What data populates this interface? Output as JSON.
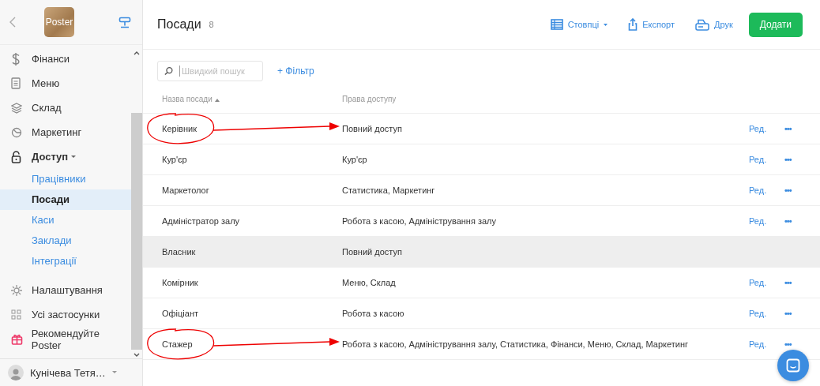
{
  "sidebar": {
    "logo": "Poster",
    "items": [
      {
        "label": "Фінанси",
        "expanded": false
      },
      {
        "label": "Меню",
        "expanded": false
      },
      {
        "label": "Склад",
        "expanded": false
      },
      {
        "label": "Маркетинг",
        "expanded": false
      },
      {
        "label": "Доступ",
        "expanded": true,
        "children": [
          {
            "label": "Працівники",
            "selected": false
          },
          {
            "label": "Посади",
            "selected": true
          },
          {
            "label": "Каси",
            "selected": false
          },
          {
            "label": "Заклади",
            "selected": false
          },
          {
            "label": "Інтеграції",
            "selected": false
          }
        ]
      },
      {
        "label": "Налаштування",
        "expanded": false
      },
      {
        "label": "Усі застосунки",
        "expanded": false
      },
      {
        "label": "Рекомендуйте Poster",
        "expanded": false
      }
    ],
    "user": "Кунічева Тетя…"
  },
  "header": {
    "title": "Посади",
    "count": "8",
    "actions": [
      "Стовпці",
      "Експорт",
      "Друк"
    ],
    "add_button": "Додати"
  },
  "search": {
    "placeholder": "Швидкий пошук"
  },
  "filter": "+ Фільтр",
  "table": {
    "columns": [
      {
        "label": "Назва посади",
        "sorted": true
      },
      {
        "label": "Права доступу",
        "sorted": false
      }
    ],
    "rows": [
      {
        "name": "Керівник",
        "access": "Повний доступ",
        "editable": true,
        "hovered": false,
        "annotated": true,
        "edit": "Ред.",
        "menu": "•••"
      },
      {
        "name": "Кур'єр",
        "access": "Кур'єр",
        "editable": true,
        "hovered": false,
        "annotated": false,
        "edit": "Ред.",
        "menu": "•••"
      },
      {
        "name": "Маркетолог",
        "access": "Статистика, Маркетинг",
        "editable": true,
        "hovered": false,
        "annotated": false,
        "edit": "Ред.",
        "menu": "•••"
      },
      {
        "name": "Адміністратор залу",
        "access": "Робота з касою, Адміністрування залу",
        "editable": true,
        "hovered": false,
        "annotated": false,
        "edit": "Ред.",
        "menu": "•••"
      },
      {
        "name": "Власник",
        "access": "Повний доступ",
        "editable": false,
        "hovered": true,
        "annotated": false
      },
      {
        "name": "Комірник",
        "access": "Меню, Склад",
        "editable": true,
        "hovered": false,
        "annotated": false,
        "edit": "Ред.",
        "menu": "•••"
      },
      {
        "name": "Офіціант",
        "access": "Робота з касою",
        "editable": true,
        "hovered": false,
        "annotated": false,
        "edit": "Ред.",
        "menu": "•••"
      },
      {
        "name": "Стажер",
        "access": "Робота з касою, Адміністрування залу, Статистика, Фінанси, Меню, Склад, Маркетинг",
        "editable": true,
        "hovered": false,
        "annotated": true,
        "edit": "Ред.",
        "menu": "•••"
      }
    ]
  }
}
